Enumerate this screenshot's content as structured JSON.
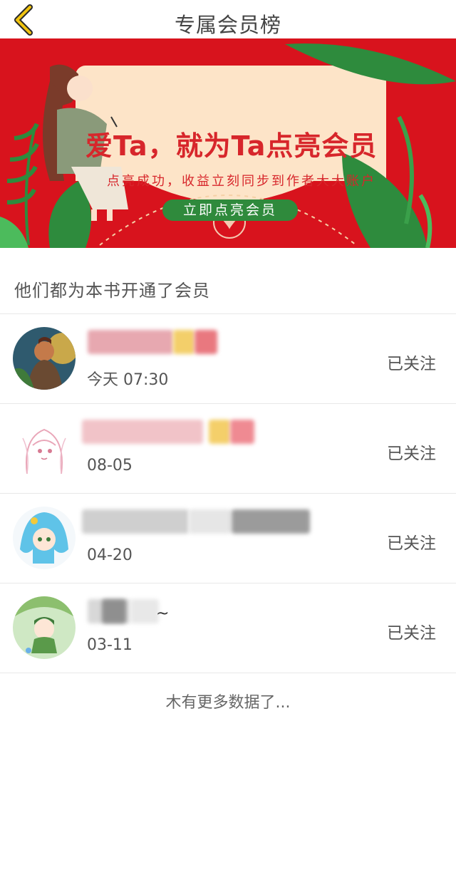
{
  "header": {
    "title": "专属会员榜",
    "back_icon": "chevron-left-icon",
    "accent": "#f1c40f"
  },
  "banner": {
    "title": "爱Ta，就为Ta点亮会员",
    "subtitle": "点亮成功，收益立刻同步到作者大大账户",
    "button": "立即点亮会员",
    "background": "#d8131d",
    "card": "#fde4c8",
    "button_color": "#2f8a3c"
  },
  "section_title": "他们都为本书开通了会员",
  "members": [
    {
      "name_tail": "",
      "time": "今天 07:30",
      "follow": "已关注"
    },
    {
      "name_tail": "",
      "time": "08-05",
      "follow": "已关注"
    },
    {
      "name_tail": "",
      "time": "04-20",
      "follow": "已关注"
    },
    {
      "name_tail": "~",
      "time": "03-11",
      "follow": "已关注"
    }
  ],
  "footer": {
    "no_more": "木有更多数据了..."
  }
}
